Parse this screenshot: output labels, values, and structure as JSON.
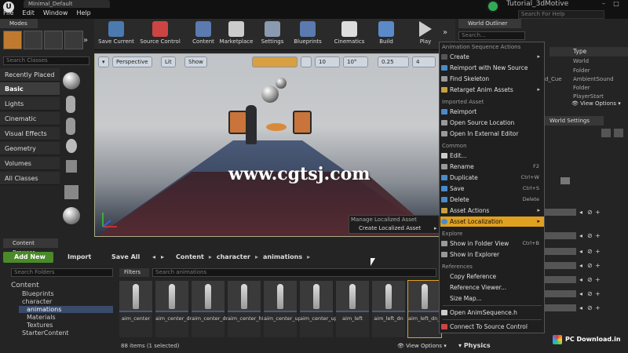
{
  "window": {
    "doc_tab": "Minimal_Default",
    "title": "Tutorial_3dMotive",
    "help_search_placeholder": "Search For Help"
  },
  "menu": [
    "File",
    "Edit",
    "Window",
    "Help"
  ],
  "modes": {
    "tab": "Modes",
    "search_placeholder": "Search Classes",
    "categories": [
      "Recently Placed",
      "Basic",
      "Lights",
      "Cinematic",
      "Visual Effects",
      "Geometry",
      "Volumes",
      "All Classes"
    ]
  },
  "toolbar": {
    "save": "Save Current",
    "source": "Source Control",
    "content": "Content",
    "marketplace": "Marketplace",
    "settings": "Settings",
    "blueprints": "Blueprints",
    "cinematics": "Cinematics",
    "build": "Build",
    "play": "Play"
  },
  "viewport": {
    "perspective": "Perspective",
    "lit": "Lit",
    "show": "Show",
    "grid": "10",
    "angle": "10°",
    "scale": "0.25",
    "cam": "4",
    "watermark": "www.cgtsj.com"
  },
  "submenu": {
    "header": "Manage Localized Asset",
    "item": "Create Localized Asset"
  },
  "context_menu": {
    "section1": "Animation Sequence Actions",
    "create": "Create",
    "reimport_skel": "Reimport with New Source",
    "find_skel": "Find Skeleton",
    "retarget": "Retarget Anim Assets",
    "section2": "Imported Asset",
    "reimport": "Reimport",
    "open_source": "Open Source Location",
    "open_ext": "Open In External Editor",
    "section3": "Common",
    "edit": "Edit...",
    "rename": "Rename",
    "rename_sc": "F2",
    "duplicate": "Duplicate",
    "duplicate_sc": "Ctrl+W",
    "save": "Save",
    "save_sc": "Ctrl+S",
    "delete": "Delete",
    "delete_sc": "Delete",
    "asset_actions": "Asset Actions",
    "asset_localization": "Asset Localization",
    "section4": "Explore",
    "show_folder": "Show in Folder View",
    "show_folder_sc": "Ctrl+B",
    "show_explorer": "Show in Explorer",
    "section5": "References",
    "copy_ref": "Copy Reference",
    "ref_viewer": "Reference Viewer...",
    "size_map": "Size Map...",
    "open_h": "Open AnimSequence.h",
    "connect": "Connect To Source Control"
  },
  "outliner": {
    "tab": "World Outliner",
    "search_placeholder": "Search...",
    "type_header": "Type",
    "types": [
      "World",
      "Folder",
      "AmbientSound",
      "Folder",
      "PlayerStart"
    ],
    "row_cue": "d_Cue",
    "view_options": "View Options"
  },
  "details": {
    "world_settings": "World Settings",
    "physics": "Physics"
  },
  "content_browser": {
    "tab": "Content Browser",
    "add_new": "Add New",
    "import": "Import",
    "save_all": "Save All",
    "crumbs": [
      "Content",
      "character",
      "animations"
    ],
    "search_folders_placeholder": "Search Folders",
    "filters": "Filters",
    "search_assets_placeholder": "Search animations",
    "tree": [
      "Content",
      "Blueprints",
      "character",
      "animations",
      "Materials",
      "Textures",
      "StarterContent"
    ],
    "assets": [
      "aim_center",
      "aim_center_dn",
      "aim_center_dn_hips",
      "aim_center_hips",
      "aim_center_up",
      "aim_center_up_hips",
      "aim_left",
      "aim_left_dn",
      "aim_left_dn_hips"
    ],
    "count": "88 items (1 selected)",
    "view_options": "View Options"
  },
  "site_badge": "PC Download.in"
}
